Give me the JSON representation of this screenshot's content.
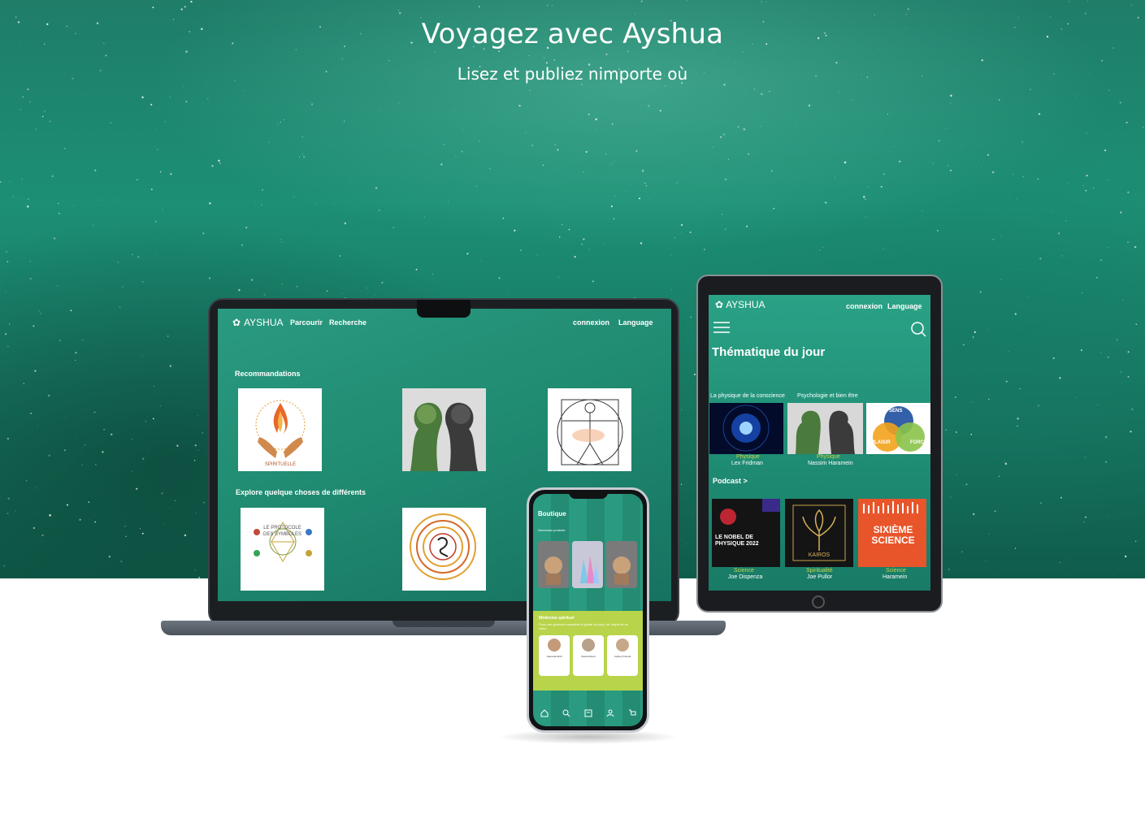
{
  "hero": {
    "title": "Voyagez avec Ayshua",
    "subtitle": "Lisez et publiez nimporte où"
  },
  "colors": {
    "accent": "#1f8a70",
    "white": "#ffffff",
    "yellow_green": "#c6d64a"
  },
  "laptop": {
    "logo": "AYSHUA",
    "nav": [
      "Parcourir",
      "Recherche"
    ],
    "right_nav": [
      "connexion",
      "Language"
    ],
    "section1": "Recommandations",
    "section2": "Explore quelque choses de différents",
    "book_text": {
      "symboles_line1": "LE PROTOCOLE",
      "symboles_line2": "DES SYMBOLES"
    }
  },
  "tablet": {
    "logo": "AYSHUA",
    "right_nav": [
      "connexion",
      "Language"
    ],
    "heading": "Thématique du jour",
    "tabs": [
      "La physique de la conscience",
      "Psychologie et bien être"
    ],
    "row1": [
      {
        "category": "Physique",
        "author": "Lex Fridman"
      },
      {
        "category": "Physique",
        "author": "Nassim Haramein"
      }
    ],
    "podcast_heading": "Podcast >",
    "podcasts": [
      {
        "category": "Science",
        "author": "Joe Dispenza",
        "cover_title": "LE NOBEL DE PHYSIQUE 2022"
      },
      {
        "category": "Spiritualité",
        "author": "Joe Pullor",
        "cover_title": "KAIROS"
      },
      {
        "category": "Science",
        "author": "Haramein",
        "cover_title": "SIXIÈME SCIENCE"
      }
    ],
    "venn_labels": [
      "SENS",
      "PLAISIR",
      "FORCE"
    ]
  },
  "phone": {
    "heading": "Boutique",
    "section": "Nouveaux produits",
    "banner_title": "Médecine spirituel",
    "banner_text": "Pour une guérison complète et global du corp, de l'esprit et de l'âme",
    "people": [
      "Juana Ercantil",
      "Pascal Alcott",
      "Audrey Francia"
    ],
    "nav_icons": [
      "home-icon",
      "search-icon",
      "book-icon",
      "user-icon",
      "cart-icon"
    ]
  }
}
